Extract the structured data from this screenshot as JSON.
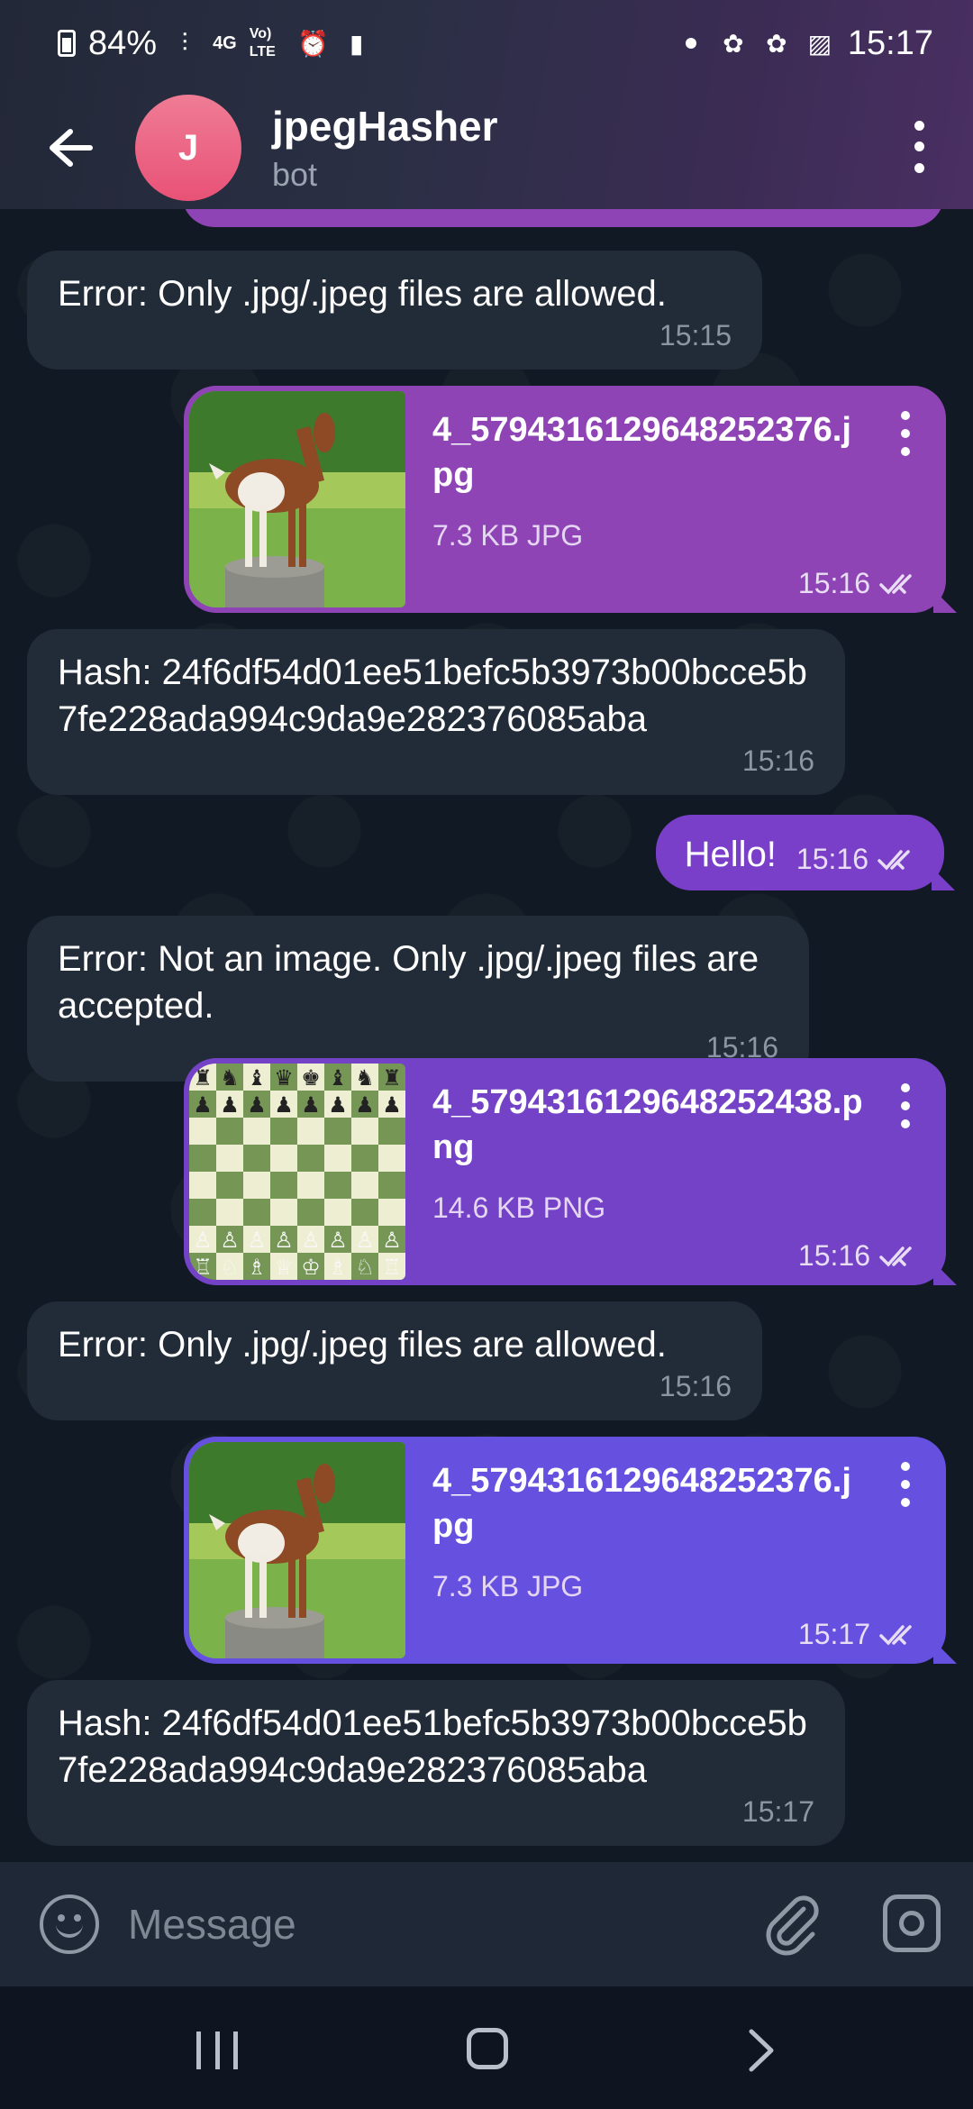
{
  "status_bar": {
    "battery": "84%",
    "net_4g": "4G",
    "volte": "Vo) LTE",
    "time": "15:17"
  },
  "header": {
    "avatar_letter": "J",
    "title": "jpegHasher",
    "subtitle": "bot"
  },
  "messages": [
    {
      "type": "incoming",
      "text": "Error: Only .jpg/.jpeg files are allowed.",
      "time": "15:15"
    },
    {
      "type": "outgoing_file",
      "filename": "4_5794316129648252376.jpg",
      "size": "7.3 KB JPG",
      "time": "15:16",
      "thumb": "goat",
      "color": "#8e44b5"
    },
    {
      "type": "incoming",
      "text": "Hash: 24f6df54d01ee51befc5b3973b00bcce5b7fe228ada994c9da9e282376085aba",
      "time": "15:16"
    },
    {
      "type": "outgoing_text",
      "text": "Hello!",
      "time": "15:16",
      "color": "#7a3fc8"
    },
    {
      "type": "incoming",
      "text": "Error: Not an image. Only .jpg/.jpeg files are accepted.",
      "time": "15:16"
    },
    {
      "type": "outgoing_file",
      "filename": "4_5794316129648252438.png",
      "size": "14.6 KB PNG",
      "time": "15:16",
      "thumb": "chess",
      "color": "#7442c7"
    },
    {
      "type": "incoming",
      "text": "Error: Only .jpg/.jpeg files are allowed.",
      "time": "15:16"
    },
    {
      "type": "outgoing_file",
      "filename": "4_5794316129648252376.jpg",
      "size": "7.3 KB JPG",
      "time": "15:17",
      "thumb": "goat",
      "color": "#6650e0"
    },
    {
      "type": "incoming",
      "text": "Hash: 24f6df54d01ee51befc5b3973b00bcce5b7fe228ada994c9da9e282376085aba",
      "time": "15:17"
    }
  ],
  "input": {
    "placeholder": "Message"
  },
  "icons": {
    "back": "arrow-left-icon",
    "menu": "more-vert-icon",
    "emoji": "smile-icon",
    "attach": "paperclip-icon",
    "camera": "camera-icon"
  }
}
